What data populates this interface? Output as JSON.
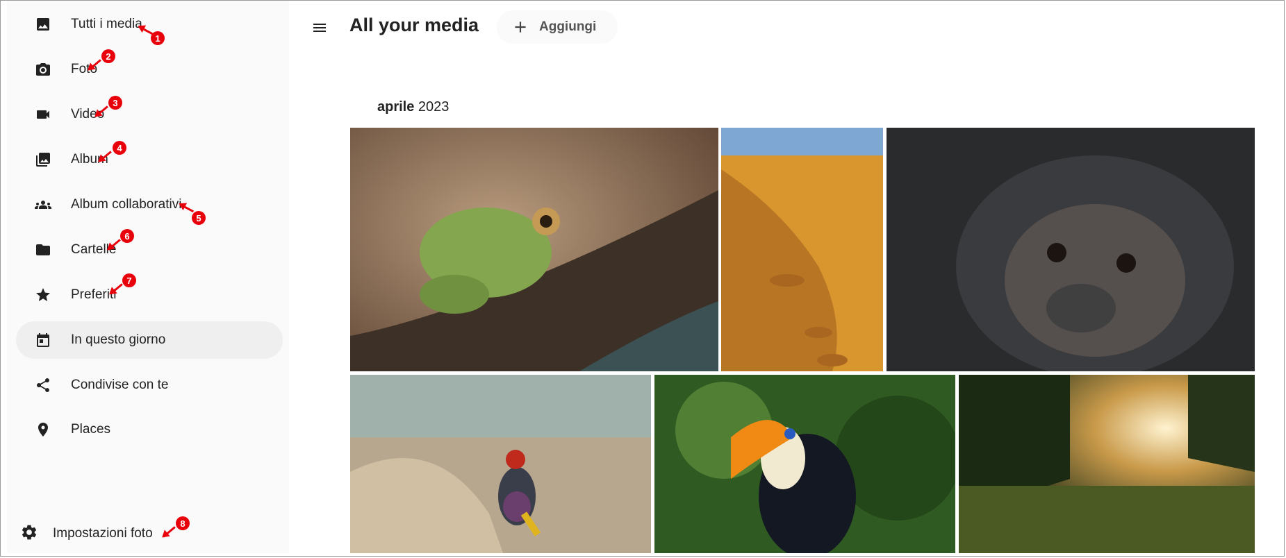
{
  "sidebar": {
    "items": [
      {
        "label": "Tutti i media",
        "icon": "image-icon"
      },
      {
        "label": "Foto",
        "icon": "camera-icon"
      },
      {
        "label": "Video",
        "icon": "video-icon"
      },
      {
        "label": "Album",
        "icon": "album-icon"
      },
      {
        "label": "Album collaborativi",
        "icon": "group-icon"
      },
      {
        "label": "Cartelle",
        "icon": "folder-icon"
      },
      {
        "label": "Preferiti",
        "icon": "star-icon"
      },
      {
        "label": "In questo giorno",
        "icon": "calendar-icon"
      },
      {
        "label": "Condivise con te",
        "icon": "share-icon"
      },
      {
        "label": "Places",
        "icon": "map-pin-icon"
      }
    ],
    "active_index": 7,
    "settings_label": "Impostazioni foto"
  },
  "header": {
    "title": "All your media",
    "add_label": "Aggiungi"
  },
  "timeline": {
    "month": "aprile",
    "year": "2023"
  },
  "photos": [
    {
      "subject": "frog"
    },
    {
      "subject": "desert-dunes"
    },
    {
      "subject": "chimpanzee"
    },
    {
      "subject": "finch-bird"
    },
    {
      "subject": "toucan"
    },
    {
      "subject": "vineyard-sunset"
    }
  ],
  "annotations": [
    "1",
    "2",
    "3",
    "4",
    "5",
    "6",
    "7",
    "8"
  ],
  "colors": {
    "accent_annotation": "#e8000b",
    "sidebar_bg": "#fafafa",
    "active_bg": "#efefef"
  }
}
